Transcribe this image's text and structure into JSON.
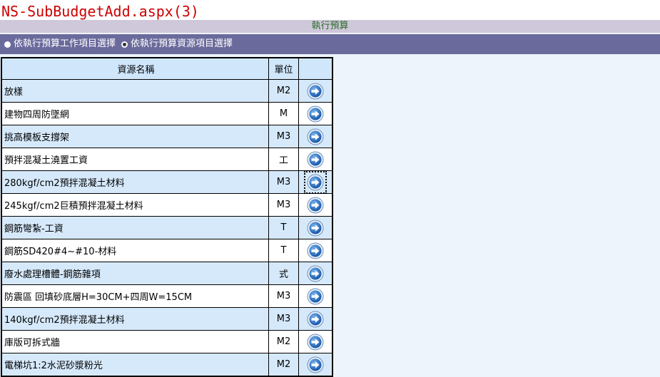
{
  "page": {
    "title": "NS-SubBudgetAdd.aspx(3)"
  },
  "section": {
    "title": "執行預算"
  },
  "mode": {
    "options": [
      {
        "label": "依執行預算工作項目選擇",
        "checked": false
      },
      {
        "label": "依執行預算資源項目選擇",
        "checked": true
      }
    ]
  },
  "table": {
    "headers": {
      "name": "資源名稱",
      "unit": "單位",
      "action": ""
    },
    "rows": [
      {
        "name": "放樣",
        "unit": "M2"
      },
      {
        "name": "建物四周防墜網",
        "unit": "M"
      },
      {
        "name": "挑高模板支撐架",
        "unit": "M3"
      },
      {
        "name": "預拌混凝土澆置工資",
        "unit": "工"
      },
      {
        "name": "280kgf/cm2預拌混凝土材料",
        "unit": "M3",
        "focused": true
      },
      {
        "name": "245kgf/cm2巨積預拌混凝土材料",
        "unit": "M3"
      },
      {
        "name": "鋼筋彎紮-工資",
        "unit": "T"
      },
      {
        "name": "鋼筋SD420#4~#10-材料",
        "unit": "T"
      },
      {
        "name": "廢水處理槽體-鋼筋雜項",
        "unit": "式"
      },
      {
        "name": "防震區 回填砂底層H=30CM+四周W=15CM",
        "unit": "M3"
      },
      {
        "name": "140kgf/cm2預拌混凝土材料",
        "unit": "M3"
      },
      {
        "name": "庫版可拆式牆",
        "unit": "M2"
      },
      {
        "name": "電梯坑1:2水泥砂漿粉光",
        "unit": "M2"
      }
    ]
  },
  "colors": {
    "title": "#cc0000",
    "section_text": "#2b6b2b",
    "section_bg": "#cfc8da",
    "mode_bg": "#6b6a9c",
    "row_alt": "#d6e9fb",
    "page_bg": "#eef4fc",
    "button_blue": "#1f6fc7"
  },
  "icons": {
    "row_action": "arrow-right-circle-icon"
  }
}
